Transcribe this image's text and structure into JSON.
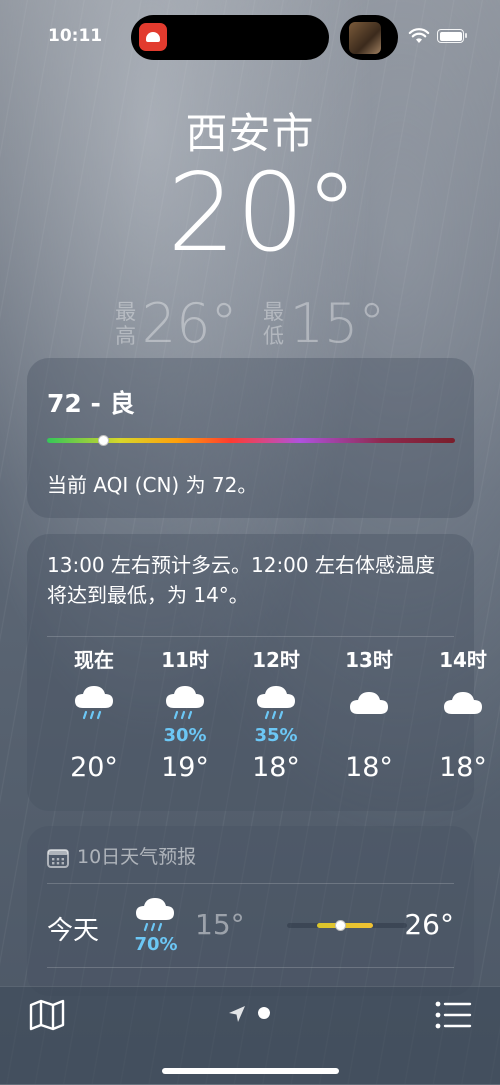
{
  "status_bar": {
    "time": "10:11"
  },
  "header": {
    "city": "西安市",
    "current_temp": "20°",
    "high_label": "最高",
    "high_value": "26°",
    "low_label": "最低",
    "low_value": "15°"
  },
  "aqi": {
    "title": "72 - 良",
    "description": "当前 AQI (CN) 为 72。",
    "value": 72,
    "indicator_fraction": 0.14
  },
  "hourly": {
    "summary": "13:00 左右预计多云。12:00 左右体感温度将达到最低，为 14°。",
    "hours": [
      {
        "label": "现在",
        "icon": "rain-cloud-icon",
        "pop": "",
        "temp": "20°"
      },
      {
        "label": "11时",
        "icon": "rain-cloud-icon",
        "pop": "30%",
        "temp": "19°"
      },
      {
        "label": "12时",
        "icon": "rain-cloud-icon",
        "pop": "35%",
        "temp": "18°"
      },
      {
        "label": "13时",
        "icon": "cloud-icon",
        "pop": "",
        "temp": "18°"
      },
      {
        "label": "14时",
        "icon": "cloud-icon",
        "pop": "",
        "temp": "18°"
      }
    ]
  },
  "daily": {
    "header": "10日天气预报",
    "days": [
      {
        "name": "今天",
        "icon": "rain-cloud-icon",
        "pop": "70%",
        "low": "15°",
        "high": "26°",
        "range_start": 0.25,
        "range_end": 0.72,
        "current": 0.45
      }
    ]
  },
  "colors": {
    "precip": "#6cc7f5",
    "range": "#f1c232"
  }
}
